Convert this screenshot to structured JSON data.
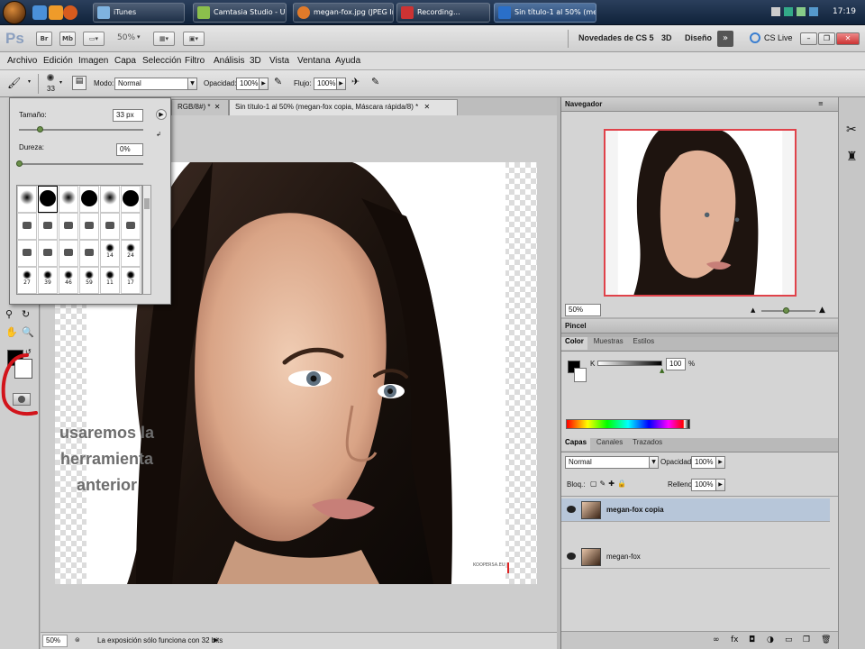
{
  "taskbar": {
    "tasks": [
      {
        "label": "iTunes",
        "color": "#7fb3e0"
      },
      {
        "label": "Camtasia Studio - Untitl...",
        "color": "#8bbf4c"
      },
      {
        "label": "megan-fox.jpg (JPEG Ima...",
        "color": "#e07a2a"
      },
      {
        "label": "Recording...",
        "color": "#c33"
      },
      {
        "label": "Sin título-1 al 50% (meg...",
        "color": "#2a6fc9"
      }
    ],
    "clock": "17:19"
  },
  "appbar": {
    "logo": "Ps",
    "br": "Br",
    "mb": "Mb",
    "zoom": "50%",
    "workspace_cs5": "Novedades de CS 5",
    "workspace_3d": "3D",
    "workspace_design": "Diseño",
    "cslive": "CS Live"
  },
  "menu": [
    "Archivo",
    "Edición",
    "Imagen",
    "Capa",
    "Selección",
    "Filtro",
    "Análisis",
    "3D",
    "Vista",
    "Ventana",
    "Ayuda"
  ],
  "options": {
    "brush_size": "33",
    "mode_label": "Modo:",
    "mode_value": "Normal",
    "opacity_label": "Opacidad:",
    "opacity_value": "100%",
    "flow_label": "Flujo:",
    "flow_value": "100%"
  },
  "brush_popup": {
    "size_label": "Tamaño:",
    "size_value": "33 px",
    "hardness_label": "Dureza:",
    "hardness_value": "0%",
    "size_fraction": 0.17,
    "hardness_fraction": 0.0,
    "row3_numbers": [
      "",
      "",
      "",
      "",
      "14",
      "24"
    ],
    "row4_numbers": [
      "27",
      "39",
      "46",
      "59",
      "11",
      "17"
    ]
  },
  "document": {
    "tab_prev": "RGB/8#) *",
    "tab_active": "Sin título-1 al 50% (megan-fox copia, Máscara rápida/8) *",
    "overlay_text_1": "usaremos la",
    "overlay_text_2": "herramienta",
    "overlay_text_3": "anterior",
    "watermark": "KOOPERSA.EU",
    "status_zoom": "50%",
    "status_msg": "La exposición sólo funciona con 32 bits"
  },
  "navigator": {
    "title": "Navegador",
    "zoom": "50%"
  },
  "brush_panel": {
    "title": "Pincel"
  },
  "color_panel": {
    "tabs": [
      "Color",
      "Muestras",
      "Estilos"
    ],
    "k_label": "K",
    "k_value": "100",
    "percent": "%",
    "k_fraction": 1.0
  },
  "layers_panel": {
    "tabs": [
      "Capas",
      "Canales",
      "Trazados"
    ],
    "blend": "Normal",
    "opacity_label": "Opacidad:",
    "opacity_value": "100%",
    "lock_label": "Bloq.:",
    "fill_label": "Relleno:",
    "fill_value": "100%",
    "layers": [
      {
        "name": "megan-fox copia",
        "selected": true
      },
      {
        "name": "megan-fox",
        "selected": false
      }
    ]
  }
}
